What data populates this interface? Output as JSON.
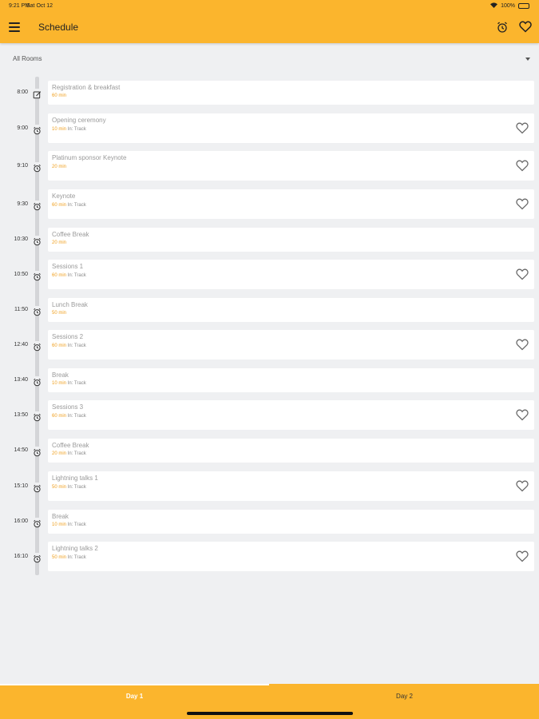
{
  "status_bar": {
    "time": "9:21 PM",
    "date": "Sat Oct 12",
    "battery": "100%"
  },
  "app_bar": {
    "title": "Schedule",
    "icons": [
      "menu-icon",
      "alarm-icon",
      "heart-icon"
    ]
  },
  "filter": {
    "selected": "All Rooms"
  },
  "sessions": [
    {
      "time": "8:00",
      "title": "Registration & breakfast",
      "duration": "60 min",
      "track": "",
      "icon": "edit-icon",
      "favoritable": false
    },
    {
      "time": "9:00",
      "title": "Opening ceremony",
      "duration": "10 min",
      "track": "In: Track",
      "icon": "alarm-icon",
      "favoritable": true
    },
    {
      "time": "9:10",
      "title": "Platinum sponsor Keynote",
      "duration": "20 min",
      "track": "",
      "icon": "alarm-icon",
      "favoritable": true
    },
    {
      "time": "9:30",
      "title": "Keynote",
      "duration": "60 min",
      "track": "In: Track",
      "icon": "alarm-icon",
      "favoritable": true
    },
    {
      "time": "10:30",
      "title": "Coffee Break",
      "duration": "20 min",
      "track": "",
      "icon": "alarm-icon",
      "favoritable": false
    },
    {
      "time": "10:50",
      "title": "Sessions 1",
      "duration": "60 min",
      "track": "In: Track",
      "icon": "alarm-icon",
      "favoritable": true
    },
    {
      "time": "11:50",
      "title": "Lunch Break",
      "duration": "50 min",
      "track": "",
      "icon": "alarm-icon",
      "favoritable": false
    },
    {
      "time": "12:40",
      "title": "Sessions 2",
      "duration": "60 min",
      "track": "In: Track",
      "icon": "alarm-icon",
      "favoritable": true
    },
    {
      "time": "13:40",
      "title": "Break",
      "duration": "10 min",
      "track": "In: Track",
      "icon": "alarm-icon",
      "favoritable": false
    },
    {
      "time": "13:50",
      "title": "Sessions 3",
      "duration": "60 min",
      "track": "In: Track",
      "icon": "alarm-icon",
      "favoritable": true
    },
    {
      "time": "14:50",
      "title": "Coffee Break",
      "duration": "20 min",
      "track": "In: Track",
      "icon": "alarm-icon",
      "favoritable": false
    },
    {
      "time": "15:10",
      "title": "Lightning talks 1",
      "duration": "50 min",
      "track": "In: Track",
      "icon": "alarm-icon",
      "favoritable": true
    },
    {
      "time": "16:00",
      "title": "Break",
      "duration": "10 min",
      "track": "In: Track",
      "icon": "alarm-icon",
      "favoritable": false
    },
    {
      "time": "16:10",
      "title": "Lightning talks 2",
      "duration": "50 min",
      "track": "In: Track",
      "icon": "alarm-icon",
      "favoritable": true
    }
  ],
  "tabs": [
    {
      "label": "Day 1",
      "selected": true
    },
    {
      "label": "Day 2",
      "selected": false
    }
  ],
  "colors": {
    "accent": "#fbb52d",
    "duration": "#f0a020",
    "background": "#eff0f2"
  }
}
